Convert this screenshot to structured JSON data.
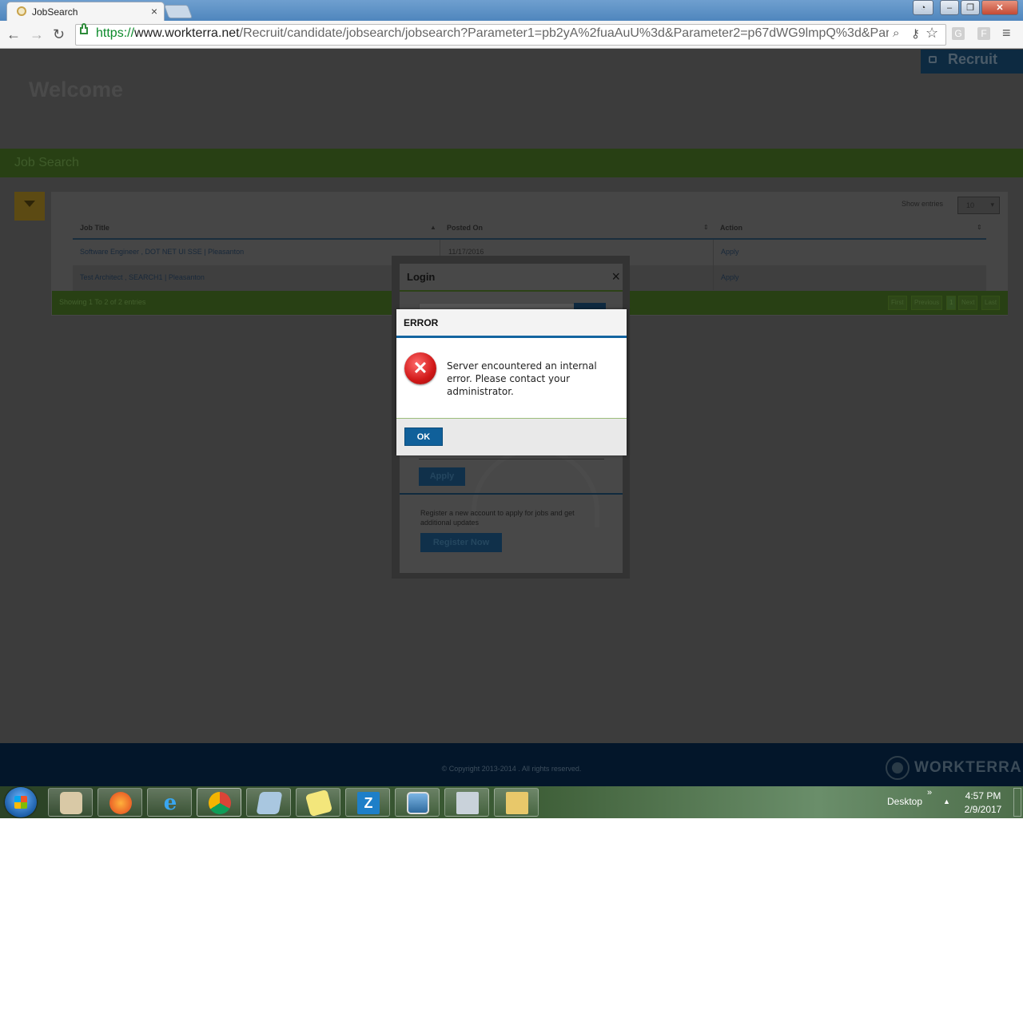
{
  "browser": {
    "tab_title": "JobSearch",
    "tab_close": "×",
    "url_scheme": "https://",
    "url_host": "www.workterra.net",
    "url_path": "/Recruit/candidate/jobsearch/jobsearch?Parameter1=pb2yA%2fuaAuU%3d&Parameter2=p67dWG9lmpQ%3d&Par",
    "back": "←",
    "forward": "→",
    "reload": "↻",
    "menu": "≡",
    "zoom_icon": "search-icon",
    "key_icon": "key-icon",
    "star_icon": "star-icon"
  },
  "site": {
    "welcome": "Welcome",
    "recruit_label": "Recruit",
    "section_title": "Job Search",
    "show_entries_label": "Show entries",
    "entries_value": "10",
    "columns": [
      "Job Title",
      "Posted On",
      "Action"
    ],
    "rows": [
      {
        "job_title": "Software Engineer , DOT NET UI SSE | Pleasanton",
        "posted_on": "11/17/2016",
        "action": "Apply"
      },
      {
        "job_title": "Test Architect , SEARCH1 | Pleasanton",
        "posted_on": "",
        "action": "Apply"
      }
    ],
    "showing_text": "Showing 1 To 2 of 2 entries",
    "pagination": [
      "First",
      "Previous",
      "1",
      "Next",
      "Last"
    ],
    "copyright": "© Copyright 2013-2014 . All rights reserved.",
    "brand": "WORKTERRA"
  },
  "login_modal": {
    "title": "Login",
    "close": "×",
    "apply_label": "Apply",
    "register_text": "Register a new account to apply for jobs and get additional updates",
    "register_label": "Register Now"
  },
  "error_dialog": {
    "title": "ERROR",
    "message": "Server encountered an internal error. Please contact your administrator.",
    "ok_label": "OK",
    "icon": "error-x-icon"
  },
  "taskbar": {
    "desktop_label": "Desktop",
    "chevron": "»",
    "tray_arrow": "▲",
    "time": "4:57 PM",
    "date": "2/9/2017",
    "apps": [
      "paint",
      "firefox",
      "internet-explorer",
      "chrome",
      "notepad",
      "sticky-notes",
      "zotero",
      "photos",
      "calculator",
      "file-explorer"
    ],
    "zotero_letter": "Z"
  },
  "colors": {
    "overlay_bg": "#3c3c3c",
    "green_bar": "#284014",
    "accent_blue": "#10609a",
    "error_red": "#d01818",
    "footer_bg": "#03162a"
  }
}
